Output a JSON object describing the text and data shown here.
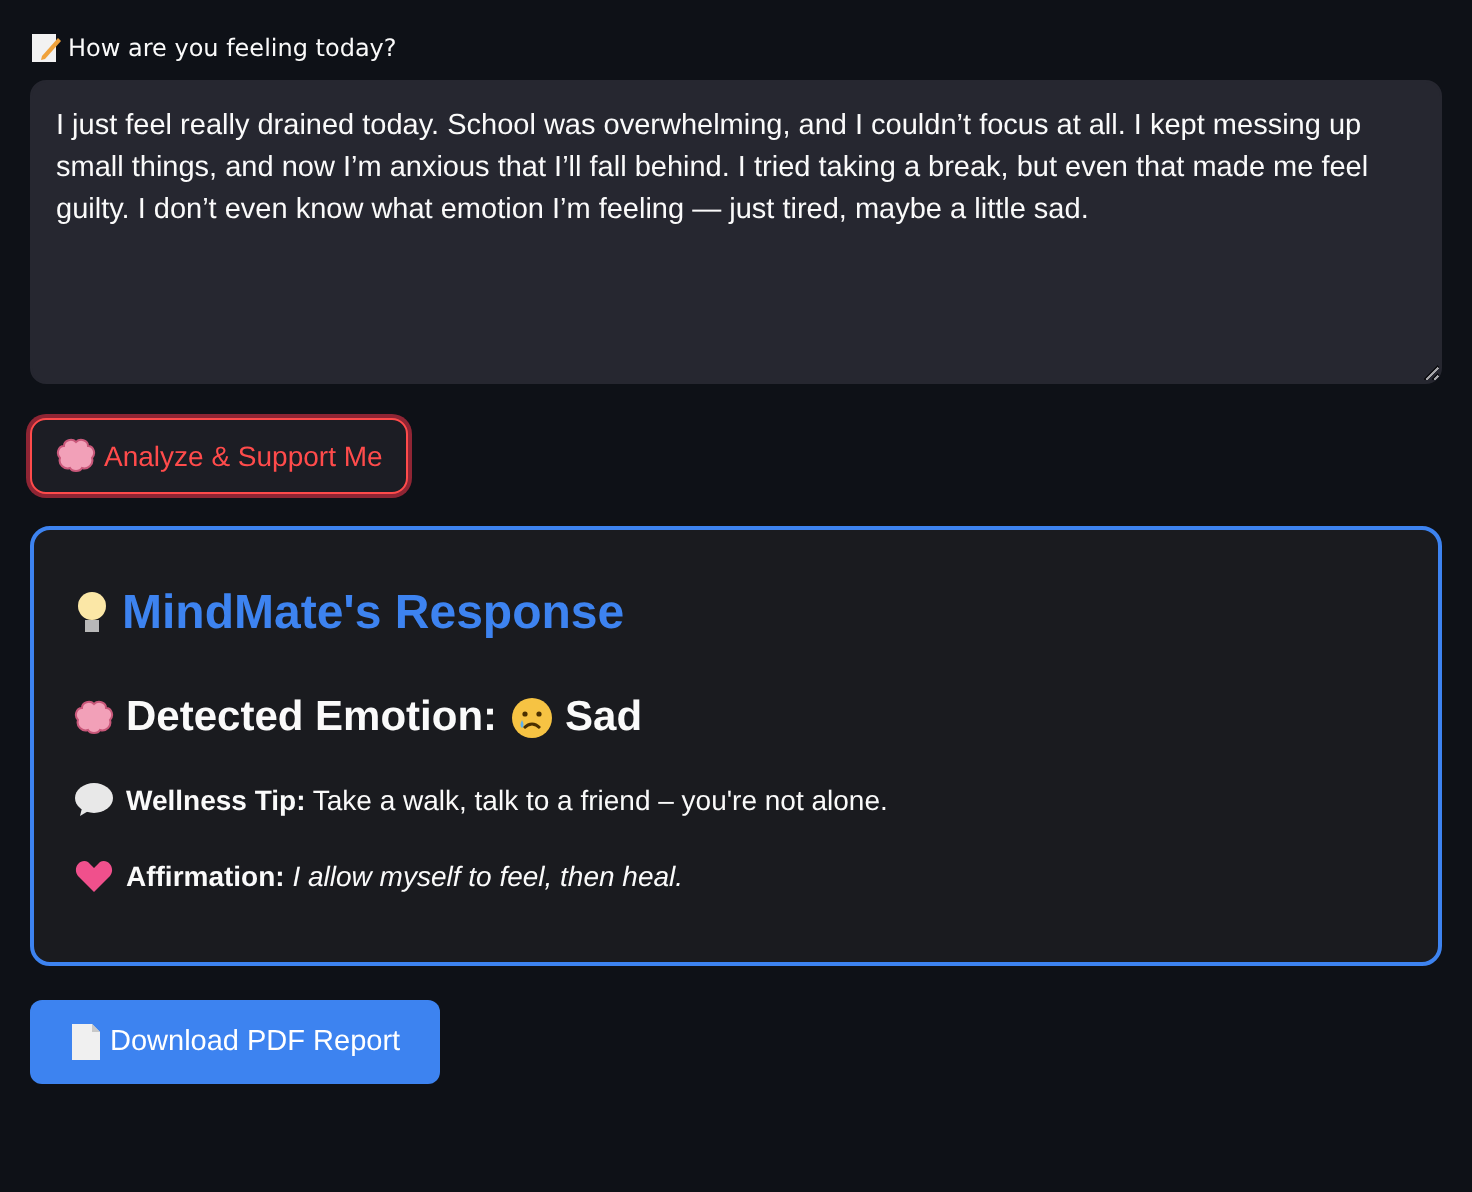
{
  "input": {
    "label": "How are you feeling today?",
    "value": "I just feel really drained today. School was overwhelming, and I couldn’t focus at all. I kept messing up small things, and now I’m anxious that I’ll fall behind. I tried taking a break, but even that made me feel guilty. I don’t even know what emotion I’m feeling — just tired, maybe a little sad."
  },
  "analyze_button": {
    "label": "Analyze & Support Me",
    "focused": true
  },
  "response": {
    "title": "MindMate's Response",
    "emotion_label": "Detected Emotion:",
    "emotion": "Sad",
    "tip": "**Wellness Tip:** Take a walk, talk to a friend – you're not alone.",
    "affirmation": "**Affirmation:** *I allow myself to feel, then heal.*"
  },
  "download_button": {
    "label": "Download PDF Report"
  }
}
